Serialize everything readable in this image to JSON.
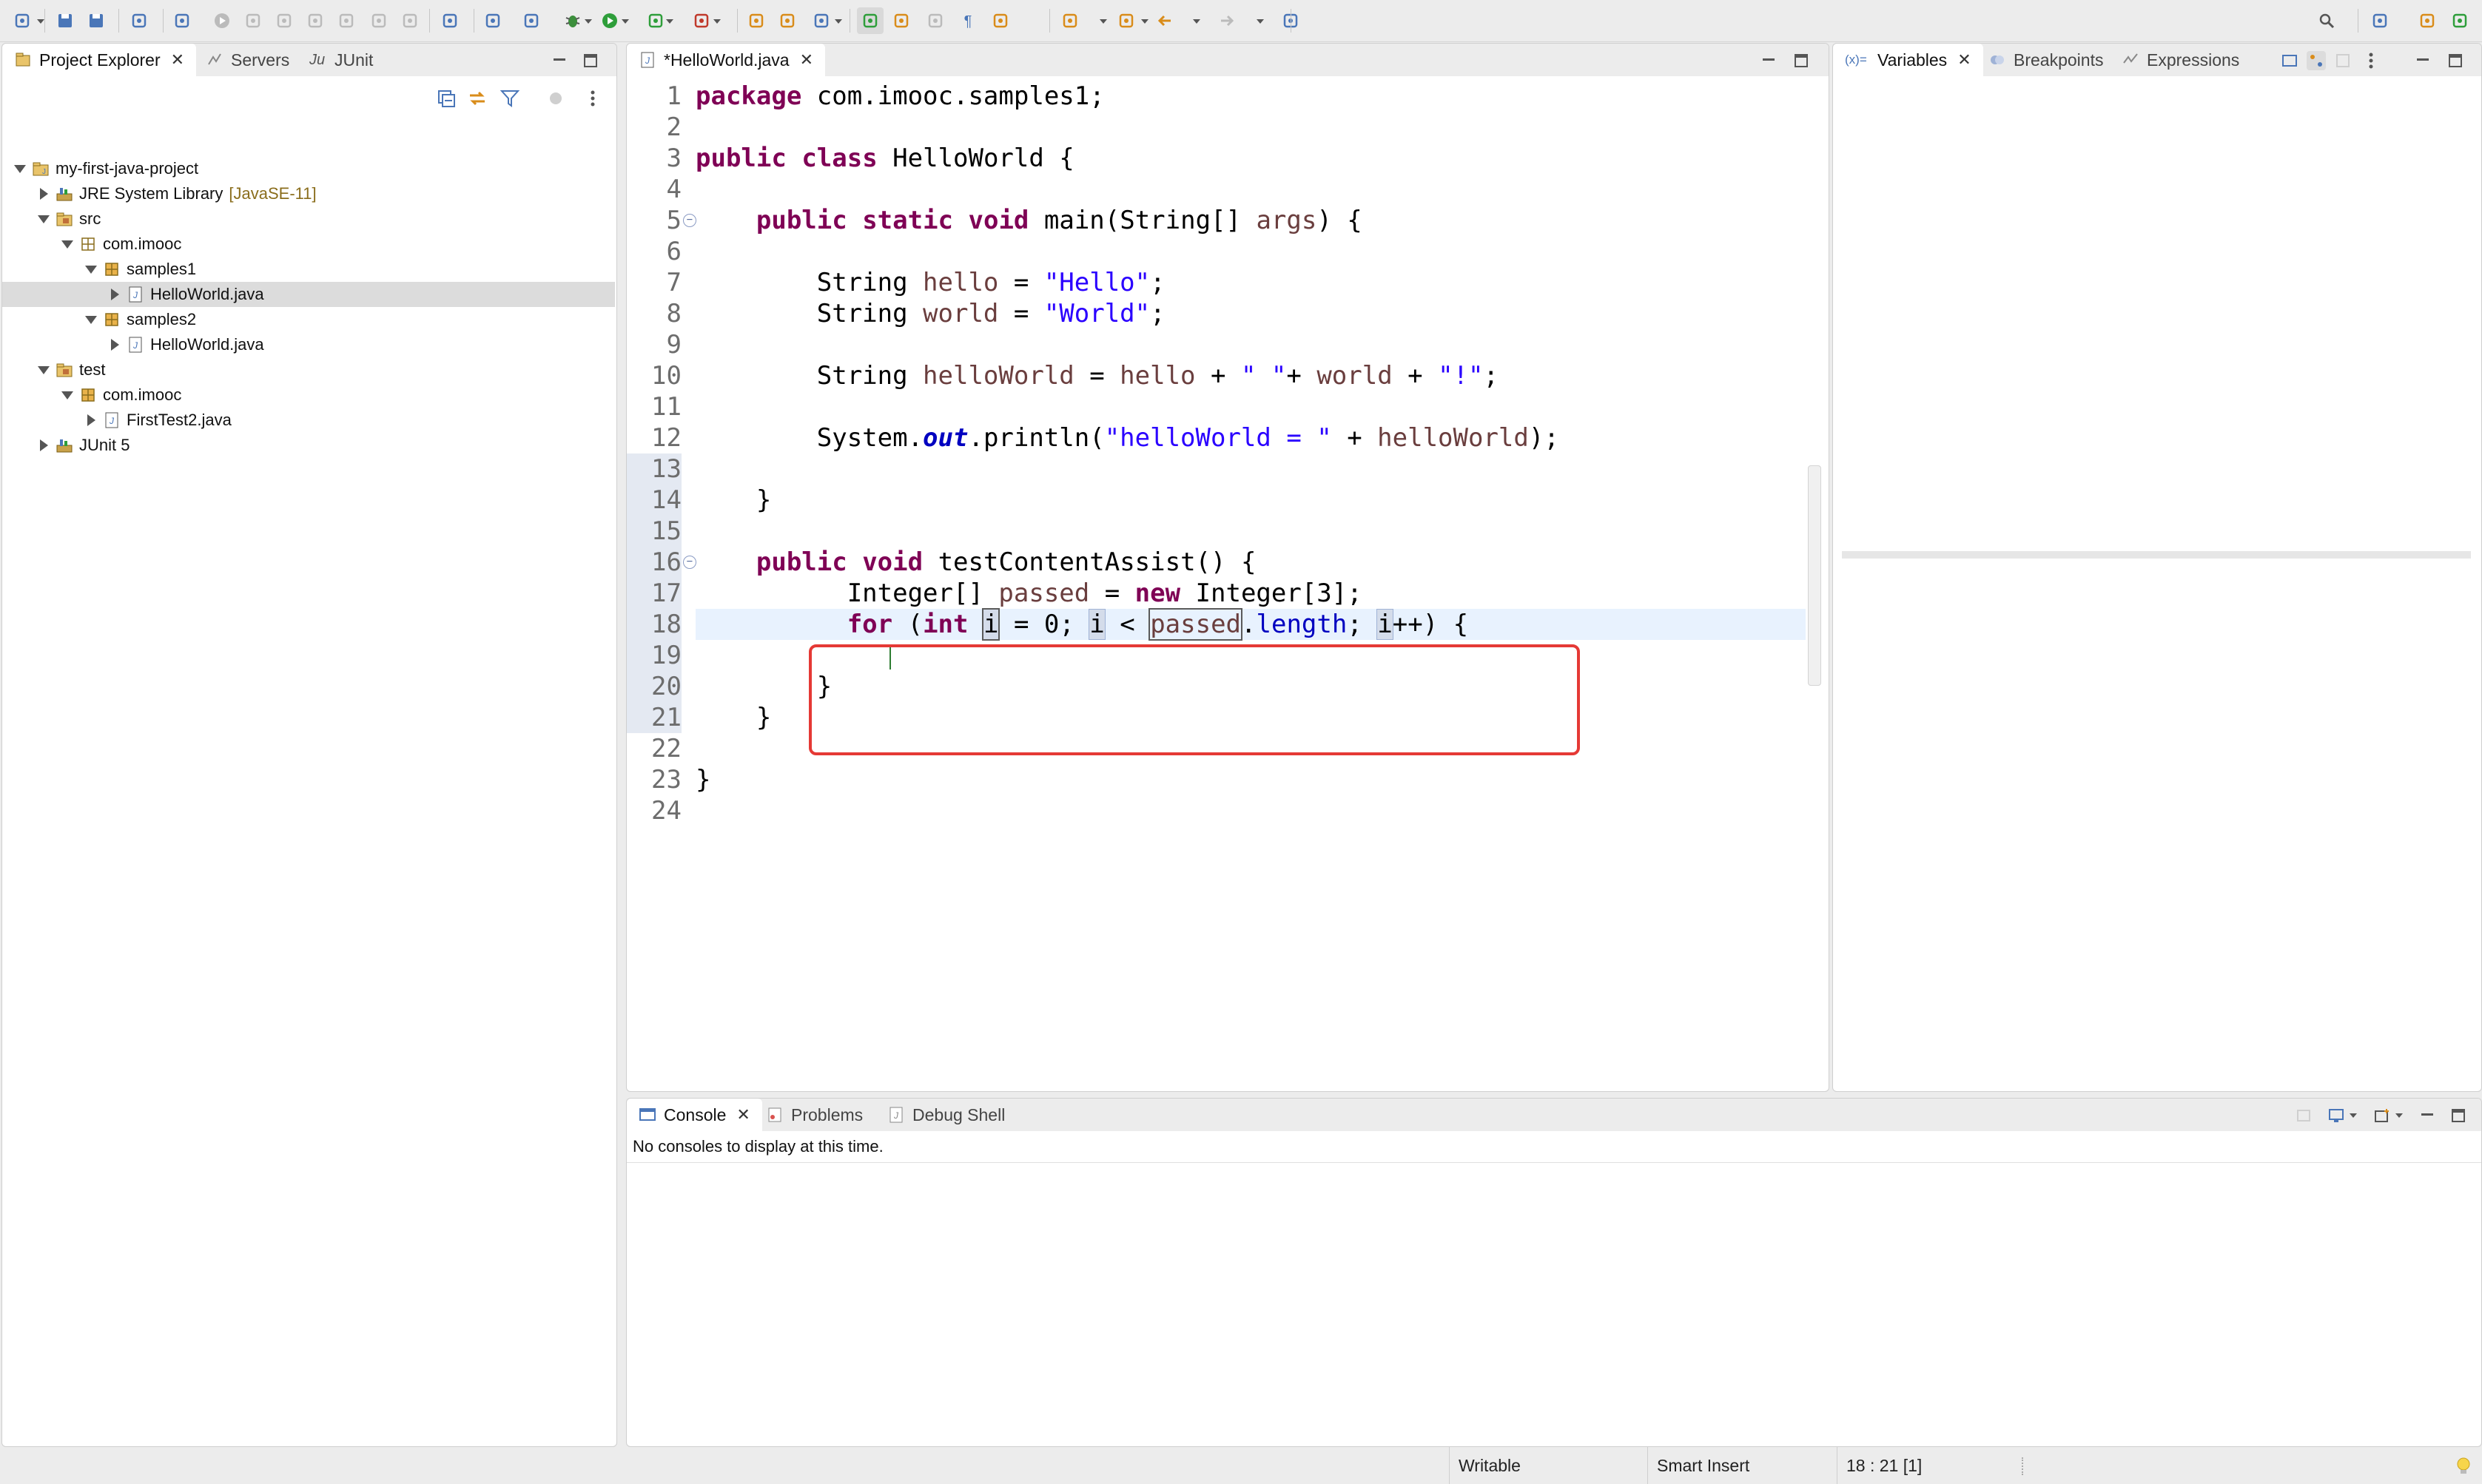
{
  "toolbar": {
    "icons": [
      "new-wizard-icon",
      "save-icon",
      "save-all-icon",
      "print-icon",
      "skip-breakpoints-icon",
      "resume-icon",
      "suspend-icon",
      "terminate-icon",
      "disconnect-icon",
      "step-into-icon",
      "step-over-icon",
      "step-return-icon",
      "build-icon",
      "refactor-icon",
      "open-console-icon",
      "debug-icon",
      "run-icon",
      "coverage-icon",
      "external-tools-icon",
      "open-type-icon",
      "open-task-icon",
      "search-icon",
      "toggle-mark-occurrences-icon",
      "toggle-highlight-icon",
      "toggle-breadcrumb-icon",
      "show-whitespace-icon",
      "next-annotation-icon",
      "previous-annotation-icon",
      "last-edit-icon",
      "back-icon",
      "forward-icon",
      "pin-editor-icon",
      "quick-access-search-icon",
      "open-perspective-icon",
      "java-perspective-icon",
      "debug-perspective-icon"
    ]
  },
  "project_explorer": {
    "tabs": [
      {
        "label": "Project Explorer",
        "icon": "project-explorer-icon",
        "active": true
      },
      {
        "label": "Servers",
        "icon": "servers-icon",
        "active": false
      },
      {
        "label": "JUnit",
        "icon": "junit-icon",
        "active": false
      }
    ],
    "tree": [
      {
        "label": "my-first-java-project",
        "icon": "java-project-icon",
        "twisty": "open",
        "depth": 0
      },
      {
        "label": "JRE System Library",
        "decoration": "[JavaSE-11]",
        "icon": "library-icon",
        "twisty": "closed",
        "depth": 1
      },
      {
        "label": "src",
        "icon": "source-folder-icon",
        "twisty": "open",
        "depth": 1
      },
      {
        "label": "com.imooc",
        "icon": "package-empty-icon",
        "twisty": "open",
        "depth": 2
      },
      {
        "label": "samples1",
        "icon": "package-icon",
        "twisty": "open",
        "depth": 3
      },
      {
        "label": "HelloWorld.java",
        "icon": "java-file-icon",
        "twisty": "closed",
        "depth": 4,
        "selected": true
      },
      {
        "label": "samples2",
        "icon": "package-icon",
        "twisty": "open",
        "depth": 3
      },
      {
        "label": "HelloWorld.java",
        "icon": "java-file-icon",
        "twisty": "closed",
        "depth": 4
      },
      {
        "label": "test",
        "icon": "source-folder-icon",
        "twisty": "open",
        "depth": 1
      },
      {
        "label": "com.imooc",
        "icon": "package-icon",
        "twisty": "open",
        "depth": 2
      },
      {
        "label": "FirstTest2.java",
        "icon": "java-file-icon",
        "twisty": "closed",
        "depth": 3
      },
      {
        "label": "JUnit 5",
        "icon": "library-icon",
        "twisty": "closed",
        "depth": 1
      }
    ]
  },
  "editor": {
    "tab_label": "*HelloWorld.java",
    "line_numbers": [
      "1",
      "2",
      "3",
      "4",
      "5",
      "6",
      "7",
      "8",
      "9",
      "10",
      "11",
      "12",
      "13",
      "14",
      "15",
      "16",
      "17",
      "18",
      "19",
      "20",
      "21",
      "22",
      "23",
      "24"
    ],
    "folding_lines": [
      "5",
      "16"
    ],
    "lines": [
      "package com.imooc.samples1;",
      "",
      "public class HelloWorld {",
      "",
      "    public static void main(String[] args) {",
      "",
      "        String hello = \"Hello\";",
      "        String world = \"World\";",
      "",
      "        String helloWorld = hello + \" \"+ world + \"!\";",
      "",
      "        System.out.println(\"helloWorld = \" + helloWorld);",
      "",
      "    }",
      "",
      "    public void testContentAssist() {",
      "          Integer[] passed = new Integer[3];",
      "          for (int i = 0; i < passed.length; i++) {",
      "",
      "        }",
      "    }",
      "",
      "}",
      ""
    ],
    "current_line": "18",
    "annotation_box_color": "#e53935"
  },
  "debug_views": {
    "tabs": [
      {
        "label": "Variables",
        "icon": "variables-icon",
        "active": true
      },
      {
        "label": "Breakpoints",
        "icon": "breakpoints-icon",
        "active": false
      },
      {
        "label": "Expressions",
        "icon": "expressions-icon",
        "active": false
      }
    ]
  },
  "console_views": {
    "tabs": [
      {
        "label": "Console",
        "icon": "console-icon",
        "active": true
      },
      {
        "label": "Problems",
        "icon": "problems-icon",
        "active": false
      },
      {
        "label": "Debug Shell",
        "icon": "debug-shell-icon",
        "active": false
      }
    ],
    "message": "No consoles to display at this time."
  },
  "statusbar": {
    "writable": "Writable",
    "insert_mode": "Smart Insert",
    "position": "18 : 21 [1]"
  },
  "colors": {
    "keyword": "#7f0055",
    "string": "#2a00ff",
    "local_var": "#6a3e3e",
    "field": "#0000c0",
    "current_line": "#e8f2fe"
  }
}
